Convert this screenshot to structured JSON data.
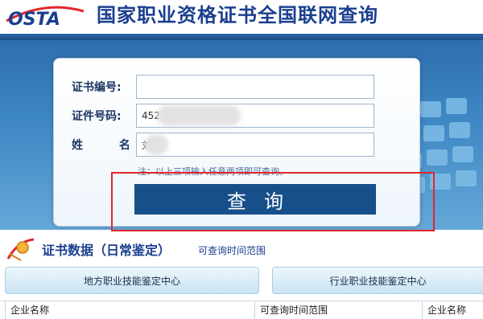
{
  "header": {
    "logo_text": "OSTA",
    "title": "国家职业资格证书全国联网查询"
  },
  "form": {
    "cert_label": "证书编号:",
    "cert_value": "",
    "id_label": "证件号码:",
    "id_value": "452",
    "name_label": "姓 名:",
    "name_value": "刘",
    "note": "注：以上三项输入任意两项即可查询。",
    "query_label": "查询"
  },
  "section": {
    "title": "证书数据（日常鉴定）",
    "subtitle": "可查询时间范围"
  },
  "tabs": [
    {
      "label": "地方职业技能鉴定中心"
    },
    {
      "label": "行业职业技能鉴定中心"
    }
  ],
  "table": {
    "headers": [
      "企业名称",
      "可查询时间范围",
      "企业名称"
    ]
  },
  "colors": {
    "brand": "#1b3f8f",
    "button": "#174f8a",
    "highlight": "#e0262b"
  }
}
